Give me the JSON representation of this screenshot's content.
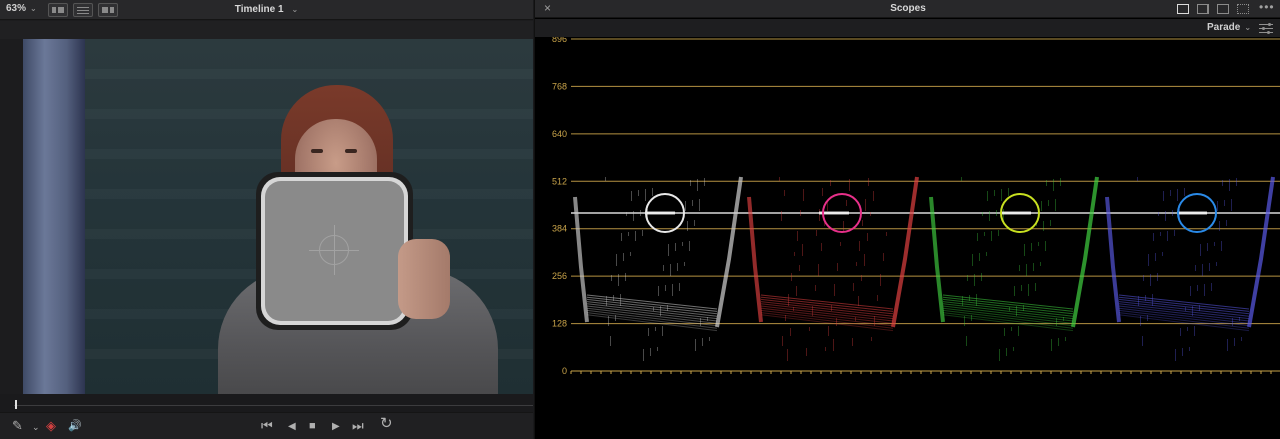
{
  "viewer": {
    "zoom_label": "63%",
    "zoom_chevron": "⌄",
    "timeline_title": "Timeline 1",
    "timeline_chevron": "⌄",
    "transport": {
      "first_icon": "⏮",
      "prev_icon": "◀",
      "stop_icon": "■",
      "play_icon": "▶",
      "last_icon": "⏭",
      "loop_icon": "↻"
    },
    "tools": {
      "picker_icon": "✎",
      "picker_chevron": "⌄",
      "layers_icon": "◈",
      "audio_icon": "🔊"
    }
  },
  "scopes": {
    "close_icon": "×",
    "title": "Scopes",
    "more_icon": "•••",
    "mode_label": "Parade",
    "mode_chevron": "⌄",
    "axis_labels": [
      "896",
      "768",
      "640",
      "512",
      "384",
      "256",
      "128",
      "0"
    ],
    "colors": {
      "grid": "#c9a44a",
      "reference": "#ffffff",
      "white_circle": "#e8e8e8",
      "red_circle": "#e8308a",
      "green_circle": "#c8e020",
      "blue_circle": "#2a8ae8",
      "red_trace": "#e04040",
      "green_trace": "#40d040",
      "blue_trace": "#5a5ae8",
      "luma_trace": "#d0d0d0"
    }
  }
}
